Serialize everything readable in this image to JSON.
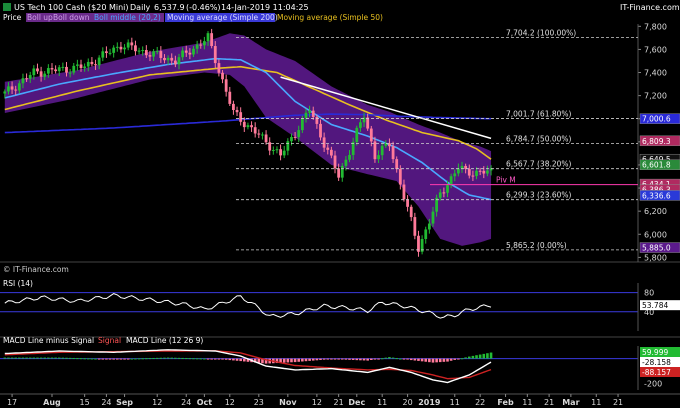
{
  "header": {
    "symbol_icon": "chart-icon",
    "title": "US Tech 100 Cash ($20 Mini)",
    "interval": "Daily",
    "last_price": "6,537.9",
    "change": "(-0.46%)",
    "datetime": "14-Jan-2019 11:04:25",
    "brand": "IT-Finance.com"
  },
  "legend": {
    "price": "Price",
    "boll_up": "Boll up",
    "boll_down": "Boll down",
    "boll_middle": "Boll middle (20,2)",
    "ma200": "Moving average (Simple 200)",
    "ma50": "Moving average (Simple 50)"
  },
  "watermark": "© IT-Finance.com",
  "colors": {
    "background": "#000000",
    "bollinger_fill": "#5b1a8c",
    "candle_up": "#22bb33",
    "candle_down": "#ff7a9a",
    "ma50": "#e8c020",
    "ma200": "#2a2ad8",
    "boll_middle": "#4aa8ff",
    "trendline": "#ffffff",
    "rsi_line": "#ffffff",
    "macd_line": "#ffffff",
    "signal_line": "#cc2222",
    "macd_hist_up": "#22bb33",
    "macd_hist_down": "#ff7a9a"
  },
  "chart_data": [
    {
      "panel": "price",
      "type": "candlestick",
      "title": "US Tech 100 Cash ($20 Mini)",
      "ylim": [
        5760,
        7820
      ],
      "y_ticks": [
        "7,800",
        "7,600",
        "7,400",
        "7,200",
        "7,000",
        "6,800",
        "6,600",
        "6,400",
        "6,200",
        "6,000",
        "5,800"
      ],
      "fibonacci": [
        {
          "label": "7,704.2 (100.00%)",
          "value": 7704.2
        },
        {
          "label": "7,001.7 (61.80%)",
          "value": 7001.7
        },
        {
          "label": "6,784.7 (50.00%)",
          "value": 6784.7
        },
        {
          "label": "6,567.7 (38.20%)",
          "value": 6567.7
        },
        {
          "label": "6,299.3 (23.60%)",
          "value": 6299.3
        },
        {
          "label": "5,865.2 (0.00%)",
          "value": 5865.2
        }
      ],
      "pivot": {
        "label": "Piv M",
        "value": 6430
      },
      "price_tags": [
        {
          "label": "7,000.6",
          "value": 7000.6,
          "color": "#2a2ad8"
        },
        {
          "label": "6,809.3",
          "value": 6809.3,
          "color": "#b02a60"
        },
        {
          "label": "6,649.5",
          "value": 6649.5,
          "color": "#111111"
        },
        {
          "label": "6,601.8",
          "value": 6601.8,
          "color": "#2a8a3a"
        },
        {
          "label": "6,434.1",
          "value": 6434.1,
          "color": "#b02a60"
        },
        {
          "label": "6,386.3",
          "value": 6386.3,
          "color": "#b02a60"
        },
        {
          "label": "6,336.6",
          "value": 6336.6,
          "color": "#2a3ad8"
        },
        {
          "label": "5,885.0",
          "value": 5885.0,
          "color": "#5b1a8c"
        }
      ],
      "key_points": [
        {
          "date": "Jul-10",
          "close": 7150
        },
        {
          "date": "Jul-25",
          "close": 7400
        },
        {
          "date": "Aug-15",
          "close": 7450
        },
        {
          "date": "Aug-29",
          "close": 7640
        },
        {
          "date": "Sep-20",
          "close": 7500
        },
        {
          "date": "Oct-01",
          "close": 7700
        },
        {
          "date": "Oct-11",
          "close": 7050
        },
        {
          "date": "Oct-24",
          "close": 6800
        },
        {
          "date": "Oct-29",
          "close": 6680
        },
        {
          "date": "Nov-08",
          "close": 7080
        },
        {
          "date": "Nov-20",
          "close": 6500
        },
        {
          "date": "Dec-03",
          "close": 7030
        },
        {
          "date": "Dec-07",
          "close": 6680
        },
        {
          "date": "Dec-13",
          "close": 6780
        },
        {
          "date": "Dec-24",
          "close": 5880
        },
        {
          "date": "Jan-04",
          "close": 6350
        },
        {
          "date": "Jan-11",
          "close": 6580
        },
        {
          "date": "Jan-14",
          "close": 6537.9
        }
      ],
      "series": [
        {
          "name": "Moving average (Simple 50)",
          "values": [
            [
              0,
              7080
            ],
            [
              20,
              7240
            ],
            [
              40,
              7380
            ],
            [
              60,
              7440
            ],
            [
              65,
              7450
            ],
            [
              75,
              7400
            ],
            [
              85,
              7260
            ],
            [
              95,
              7120
            ],
            [
              105,
              6990
            ],
            [
              115,
              6880
            ],
            [
              125,
              6810
            ],
            [
              130,
              6740
            ],
            [
              134,
              6650
            ]
          ]
        },
        {
          "name": "Moving average (Simple 200)",
          "values": [
            [
              0,
              6880
            ],
            [
              30,
              6920
            ],
            [
              60,
              6980
            ],
            [
              80,
              7030
            ],
            [
              90,
              7040
            ],
            [
              100,
              7035
            ],
            [
              110,
              7020
            ],
            [
              120,
              7010
            ],
            [
              134,
              7000
            ]
          ]
        },
        {
          "name": "Boll middle (20,2)",
          "values": [
            [
              0,
              7180
            ],
            [
              15,
              7300
            ],
            [
              30,
              7390
            ],
            [
              45,
              7470
            ],
            [
              58,
              7520
            ],
            [
              65,
              7510
            ],
            [
              72,
              7400
            ],
            [
              80,
              7150
            ],
            [
              90,
              6950
            ],
            [
              100,
              6850
            ],
            [
              108,
              6750
            ],
            [
              115,
              6620
            ],
            [
              122,
              6450
            ],
            [
              128,
              6340
            ],
            [
              134,
              6300
            ]
          ]
        }
      ],
      "bollinger_band": {
        "upper": [
          [
            0,
            7320
          ],
          [
            20,
            7420
          ],
          [
            40,
            7580
          ],
          [
            55,
            7660
          ],
          [
            62,
            7740
          ],
          [
            66,
            7720
          ],
          [
            72,
            7600
          ],
          [
            80,
            7500
          ],
          [
            90,
            7280
          ],
          [
            100,
            7120
          ],
          [
            106,
            7060
          ],
          [
            114,
            6950
          ],
          [
            120,
            6880
          ],
          [
            126,
            6800
          ],
          [
            131,
            6760
          ],
          [
            134,
            6720
          ]
        ],
        "lower": [
          [
            0,
            7050
          ],
          [
            20,
            7180
          ],
          [
            40,
            7340
          ],
          [
            55,
            7400
          ],
          [
            62,
            7380
          ],
          [
            66,
            7280
          ],
          [
            72,
            7010
          ],
          [
            80,
            6840
          ],
          [
            90,
            6600
          ],
          [
            100,
            6520
          ],
          [
            108,
            6460
          ],
          [
            114,
            6240
          ],
          [
            120,
            5960
          ],
          [
            126,
            5900
          ],
          [
            131,
            5930
          ],
          [
            134,
            5960
          ]
        ]
      },
      "trendline": {
        "from": [
          76,
          7360
        ],
        "to": [
          134,
          6830
        ]
      }
    },
    {
      "panel": "rsi",
      "type": "line",
      "title": "RSI (14)",
      "ylim": [
        0,
        100
      ],
      "levels": [
        80,
        40
      ],
      "tick_labels": [
        "80",
        "40"
      ],
      "current": "53.784",
      "key_points": [
        [
          0,
          58
        ],
        [
          10,
          70
        ],
        [
          20,
          62
        ],
        [
          30,
          74
        ],
        [
          40,
          65
        ],
        [
          50,
          55
        ],
        [
          55,
          45
        ],
        [
          60,
          58
        ],
        [
          65,
          72
        ],
        [
          70,
          48
        ],
        [
          73,
          30
        ],
        [
          80,
          36
        ],
        [
          88,
          52
        ],
        [
          95,
          48
        ],
        [
          100,
          42
        ],
        [
          104,
          60
        ],
        [
          110,
          52
        ],
        [
          116,
          40
        ],
        [
          121,
          28
        ],
        [
          124,
          33
        ],
        [
          128,
          45
        ],
        [
          134,
          53.8
        ]
      ]
    },
    {
      "panel": "macd",
      "type": "line",
      "title": "MACD Line minus Signal",
      "legend": [
        "MACD Line minus Signal",
        "Signal",
        "MACD Line (12 26 9)"
      ],
      "ylim": [
        -250,
        100
      ],
      "tick_labels": [
        "0",
        "-100",
        "-200"
      ],
      "current": {
        "hist": "59.999",
        "macd": "-28.158",
        "signal": "-88.157"
      },
      "macd": [
        [
          0,
          40
        ],
        [
          15,
          60
        ],
        [
          30,
          50
        ],
        [
          45,
          70
        ],
        [
          58,
          60
        ],
        [
          65,
          20
        ],
        [
          72,
          -60
        ],
        [
          80,
          -90
        ],
        [
          90,
          -80
        ],
        [
          100,
          -110
        ],
        [
          106,
          -70
        ],
        [
          112,
          -110
        ],
        [
          118,
          -170
        ],
        [
          122,
          -190
        ],
        [
          128,
          -130
        ],
        [
          134,
          -28
        ]
      ],
      "signal": [
        [
          0,
          30
        ],
        [
          15,
          50
        ],
        [
          30,
          55
        ],
        [
          45,
          60
        ],
        [
          58,
          62
        ],
        [
          65,
          45
        ],
        [
          72,
          -10
        ],
        [
          80,
          -55
        ],
        [
          90,
          -75
        ],
        [
          100,
          -90
        ],
        [
          106,
          -85
        ],
        [
          112,
          -95
        ],
        [
          118,
          -130
        ],
        [
          122,
          -160
        ],
        [
          128,
          -150
        ],
        [
          134,
          -88
        ]
      ]
    }
  ],
  "x_axis": {
    "labels": [
      {
        "text": "17",
        "i": 2
      },
      {
        "text": "Aug",
        "i": 13,
        "bold": true
      },
      {
        "text": "15",
        "i": 22
      },
      {
        "text": "24",
        "i": 28
      },
      {
        "text": "Sep",
        "i": 33,
        "bold": true
      },
      {
        "text": "12",
        "i": 42
      },
      {
        "text": "24",
        "i": 50
      },
      {
        "text": "Oct",
        "i": 55,
        "bold": true
      },
      {
        "text": "12",
        "i": 62
      },
      {
        "text": "23",
        "i": 70
      },
      {
        "text": "Nov",
        "i": 78,
        "bold": true
      },
      {
        "text": "12",
        "i": 86
      },
      {
        "text": "21",
        "i": 92
      },
      {
        "text": "Dec",
        "i": 97,
        "bold": true
      },
      {
        "text": "11",
        "i": 104
      },
      {
        "text": "20",
        "i": 111
      },
      {
        "text": "2019",
        "i": 117,
        "bold": true
      },
      {
        "text": "11",
        "i": 124
      },
      {
        "text": "22",
        "i": 131
      },
      {
        "text": "Feb",
        "i": 138,
        "bold": true
      },
      {
        "text": "11",
        "i": 144
      },
      {
        "text": "21",
        "i": 150
      },
      {
        "text": "Mar",
        "i": 156,
        "bold": true
      },
      {
        "text": "11",
        "i": 163
      },
      {
        "text": "21",
        "i": 169
      }
    ]
  }
}
